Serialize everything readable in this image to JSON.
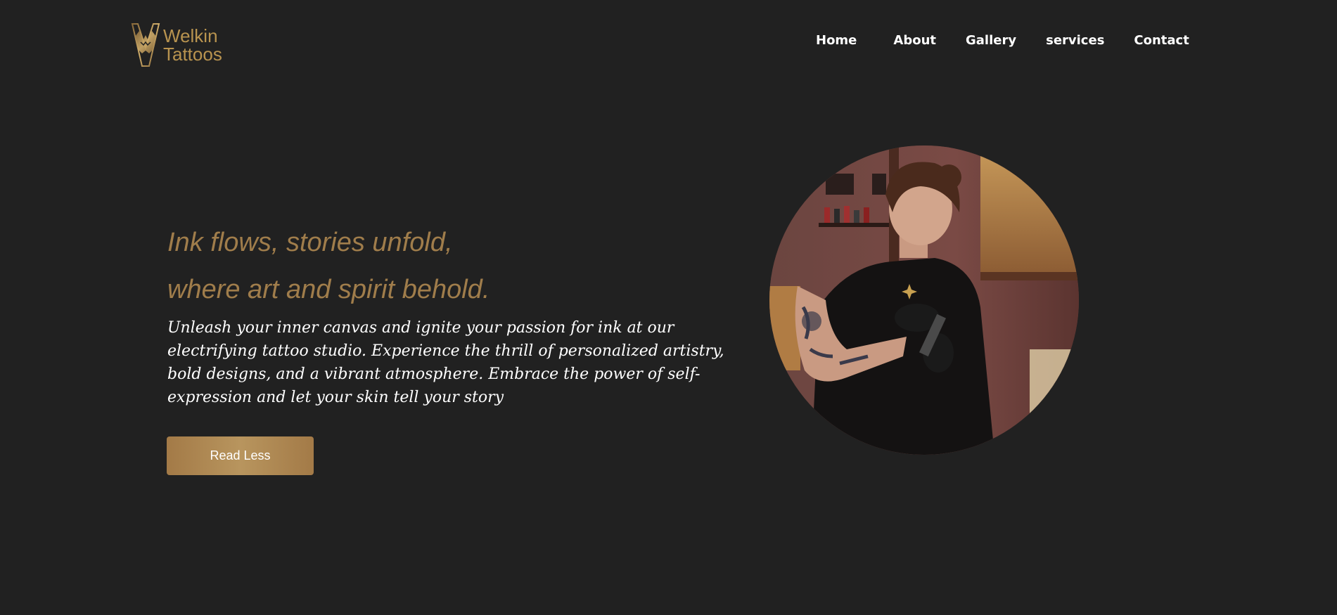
{
  "brand": {
    "name_line1": "Welkin",
    "name_line2": "Tattoos",
    "logo_icon": "wolf-head-icon",
    "accent_color": "#b8934f"
  },
  "nav": {
    "items": [
      {
        "label": "Home"
      },
      {
        "label": "About"
      },
      {
        "label": "Gallery"
      },
      {
        "label": "services"
      },
      {
        "label": "Contact"
      }
    ]
  },
  "hero": {
    "heading_line1": "Ink flows, stories unfold,",
    "heading_line2": "where art and spirit behold.",
    "paragraph": "Unleash your inner canvas and ignite your passion for ink at our electrifying tattoo studio. Experience the thrill of personalized artistry, bold designs, and a vibrant atmosphere. Embrace the power of self-expression and let your skin tell your story",
    "button_label": "Read Less",
    "image_subject": "tattoo-artist-photo"
  },
  "colors": {
    "background": "#212121",
    "heading": "#a07d4b",
    "button": "#a88350"
  }
}
